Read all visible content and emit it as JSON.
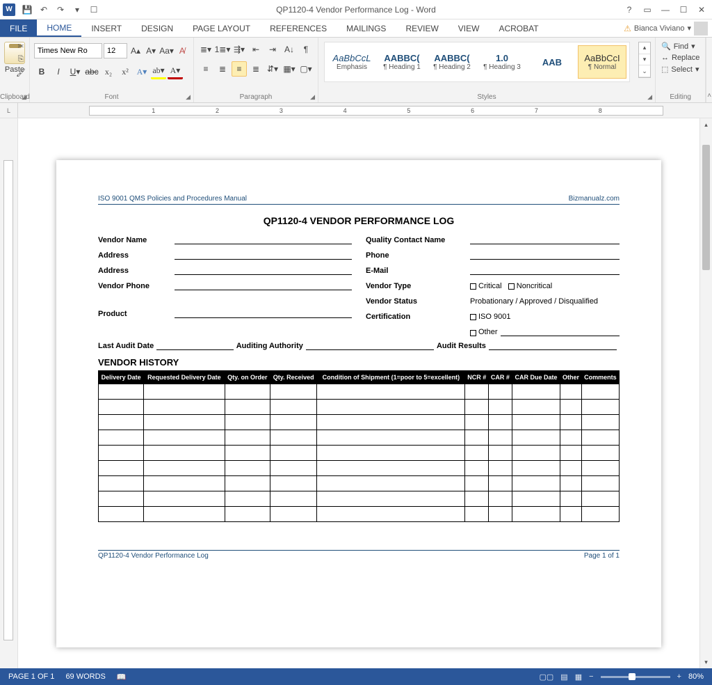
{
  "titlebar": {
    "title": "QP1120-4 Vendor Performance Log - Word"
  },
  "tabs": {
    "file": "FILE",
    "home": "HOME",
    "insert": "INSERT",
    "design": "DESIGN",
    "page_layout": "PAGE LAYOUT",
    "references": "REFERENCES",
    "mailings": "MAILINGS",
    "review": "REVIEW",
    "view": "VIEW",
    "acrobat": "ACROBAT"
  },
  "user": {
    "name": "Bianca Viviano"
  },
  "ribbon": {
    "clipboard": {
      "paste": "Paste",
      "label": "Clipboard"
    },
    "font": {
      "name": "Times New Ro",
      "size": "12",
      "label": "Font"
    },
    "paragraph": {
      "label": "Paragraph"
    },
    "styles": {
      "label": "Styles",
      "items": [
        {
          "preview": "AaBbCcL",
          "name": "Emphasis"
        },
        {
          "preview": "AABBC(",
          "name": "¶ Heading 1"
        },
        {
          "preview": "AABBC(",
          "name": "¶ Heading 2"
        },
        {
          "preview": "1.0",
          "name": "¶ Heading 3"
        },
        {
          "preview": "AAB",
          "name": ""
        },
        {
          "preview": "AaBbCcI",
          "name": "¶ Normal"
        }
      ]
    },
    "editing": {
      "find": "Find",
      "replace": "Replace",
      "select": "Select",
      "label": "Editing"
    }
  },
  "doc": {
    "header_left": "ISO 9001 QMS Policies and Procedures Manual",
    "header_right": "Bizmanualz.com",
    "title": "QP1120-4 VENDOR PERFORMANCE LOG",
    "left_fields": {
      "vendor_name": "Vendor Name",
      "address1": "Address",
      "address2": "Address",
      "vendor_phone": "Vendor Phone",
      "product": "Product"
    },
    "right_fields": {
      "qcn": "Quality Contact Name",
      "phone": "Phone",
      "email": "E-Mail",
      "vendor_type": "Vendor Type",
      "critical": "Critical",
      "noncritical": "Noncritical",
      "vendor_status": "Vendor Status",
      "status_opts": "Probationary / Approved / Disqualified",
      "certification": "Certification",
      "iso": "ISO 9001",
      "other": "Other"
    },
    "audit": {
      "last": "Last Audit Date",
      "auth": "Auditing Authority",
      "results": "Audit Results"
    },
    "vhist": "VENDOR HISTORY",
    "cols": [
      "Delivery Date",
      "Requested Delivery Date",
      "Qty. on Order",
      "Qty. Received",
      "Condition of Shipment (1=poor to 5=excellent)",
      "NCR #",
      "CAR #",
      "CAR Due Date",
      "Other",
      "Comments"
    ],
    "footer_left": "QP1120-4 Vendor Performance Log",
    "footer_right": "Page 1 of 1"
  },
  "status": {
    "page": "PAGE 1 OF 1",
    "words": "69 WORDS",
    "zoom": "80%"
  }
}
